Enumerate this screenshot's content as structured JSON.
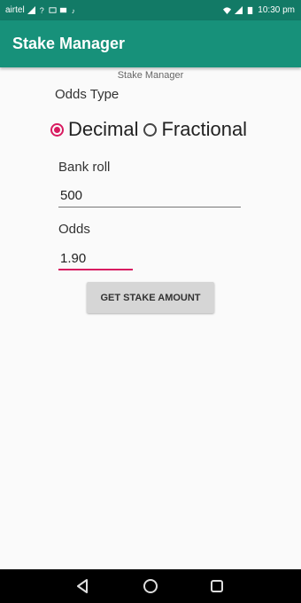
{
  "status": {
    "carrier": "airtel",
    "time": "10:30 pm"
  },
  "appbar": {
    "title": "Stake Manager"
  },
  "form": {
    "subtitle": "Stake Manager",
    "odds_type_label": "Odds Type",
    "radio_decimal": "Decimal",
    "radio_fractional": "Fractional",
    "selected_odds_type": "Decimal",
    "bankroll_label": "Bank roll",
    "bankroll_value": "500",
    "odds_label": "Odds",
    "odds_value": "1.90",
    "button_label": "GET STAKE AMOUNT"
  },
  "colors": {
    "primary": "#17917a",
    "primary_dark": "#127a66",
    "accent": "#d81b60"
  }
}
